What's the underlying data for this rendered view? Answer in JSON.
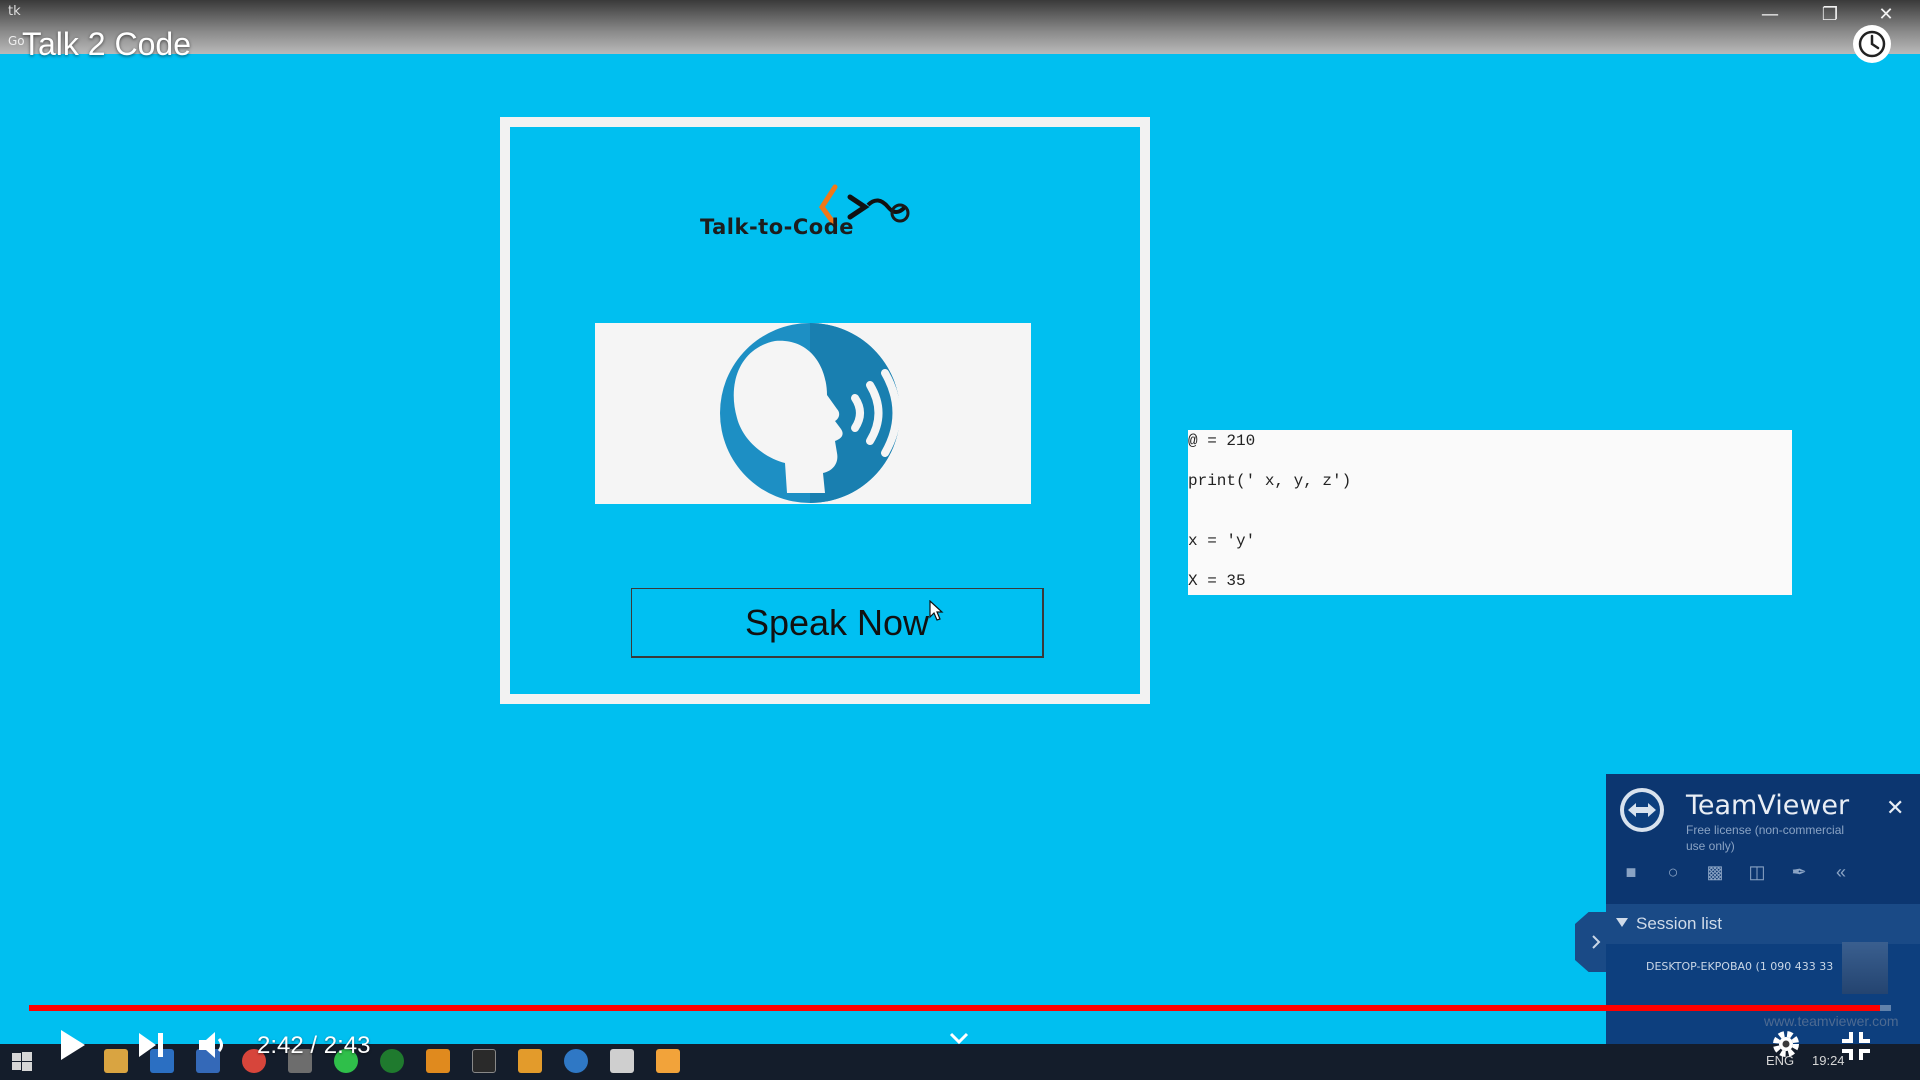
{
  "window": {
    "app_name": "tk",
    "sub_label": "Go",
    "minimize_glyph": "—",
    "restore_glyph": "❐",
    "close_glyph": "✕"
  },
  "player": {
    "video_title": "Talk 2 Code",
    "current_time": "2:42",
    "duration": "2:43",
    "time_display": "2:42 / 2:43",
    "progress_fraction": 0.994,
    "progress_color": "#ff0000"
  },
  "app": {
    "logo_text": "Talk-to-Code",
    "speak_button_label": "Speak Now",
    "background_color": "#00bff0"
  },
  "code_output": {
    "lines": [
      "@ = 210",
      "print(' x, y, z')",
      "x = 'y'",
      "X = 35"
    ]
  },
  "teamviewer": {
    "title": "TeamViewer",
    "subtitle": "Free license (non-commercial use only)",
    "session_list_label": "Session list",
    "device_label": "DESKTOP-EKPOBA0 (1 090 433 33",
    "watermark": "www.teamviewer.com",
    "close_glyph": "✕"
  },
  "taskbar": {
    "language": "ENG",
    "clock": "19:24"
  },
  "icons": {
    "watch_later": "clock-icon",
    "play": "play-icon",
    "next": "next-icon",
    "volume": "volume-icon",
    "chevron": "chevron-down-icon",
    "settings": "gear-icon",
    "fullscreen_exit": "exit-fullscreen-icon"
  }
}
